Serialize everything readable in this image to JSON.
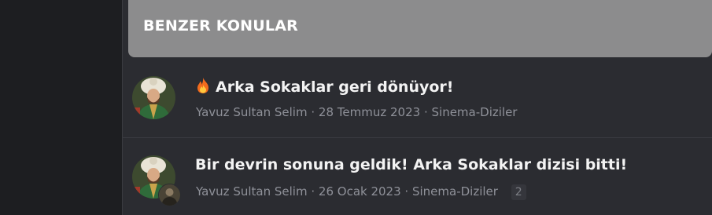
{
  "section": {
    "title": "BENZER KONULAR"
  },
  "threads": [
    {
      "title": "Arka Sokaklar geri dönüyor!",
      "has_fire_emoji": true,
      "author": "Yavuz Sultan Selim",
      "date": "28 Temmuz 2023",
      "forum": "Sinema-Diziler",
      "separator": "·"
    },
    {
      "title": "Bir devrin sonuna geldik! Arka Sokaklar dizisi bitti!",
      "has_fire_emoji": false,
      "author": "Yavuz Sultan Selim",
      "date": "26 Ocak 2023",
      "forum": "Sinema-Diziler",
      "separator": "·",
      "replies": "2"
    }
  ],
  "colors": {
    "background": "#1d1e21",
    "panel": "#2b2c31",
    "header": "#8c8c8d",
    "title_text": "#f3f3f3",
    "meta_text": "#8f9199"
  },
  "icons": {
    "fire": "fire-icon",
    "avatar": "avatar-icon"
  }
}
